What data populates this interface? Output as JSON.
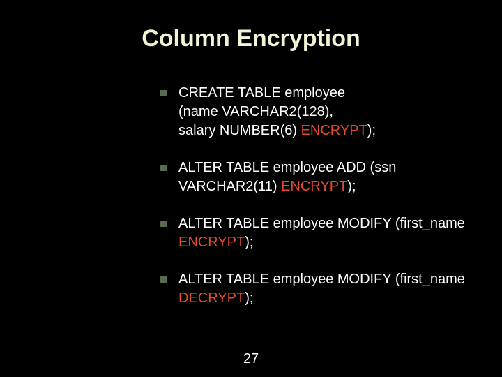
{
  "title": "Column Encryption",
  "items": [
    {
      "l1a": "CREATE TABLE employee",
      "l2a": "(name VARCHAR2(128),",
      "l3a": "salary NUMBER(6) ",
      "l3kw": "ENCRYPT",
      "l3b": ");"
    },
    {
      "l1a": "ALTER TABLE employee ADD (ssn VARCHAR2(11) ",
      "l1kw": "ENCRYPT",
      "l1b": ");"
    },
    {
      "l1a": "ALTER TABLE employee MODIFY (first_name ",
      "l1kw": "ENCRYPT",
      "l1b": ");"
    },
    {
      "l1a": "ALTER TABLE employee MODIFY (first_name ",
      "l1kw": "DECRYPT",
      "l1b": ");"
    }
  ],
  "page": "27"
}
